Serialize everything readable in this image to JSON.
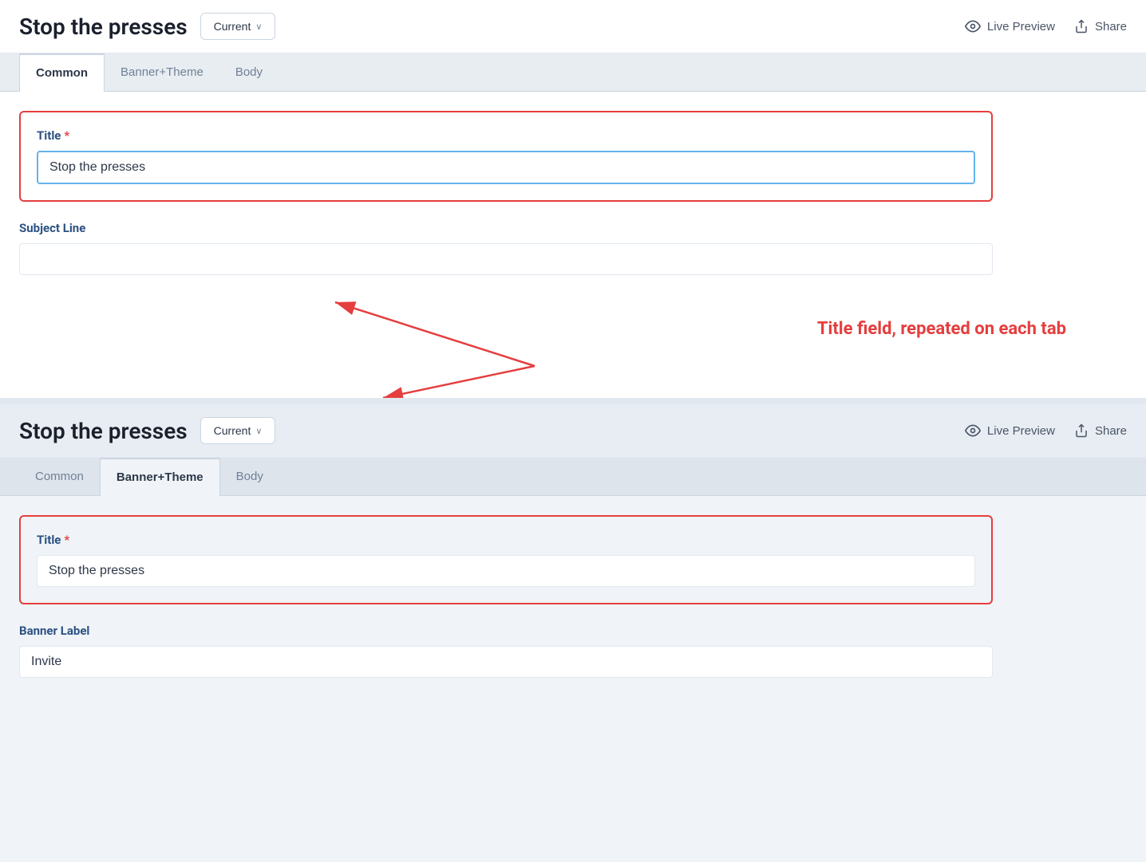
{
  "app": {
    "title": "Stop the presses"
  },
  "panel1": {
    "header": {
      "title": "Stop the presses",
      "dropdown_label": "Current",
      "live_preview_label": "Live Preview",
      "share_label": "Share"
    },
    "tabs": [
      {
        "id": "common",
        "label": "Common",
        "active": true
      },
      {
        "id": "banner-theme",
        "label": "Banner+Theme",
        "active": false
      },
      {
        "id": "body",
        "label": "Body",
        "active": false
      }
    ],
    "form": {
      "title_label": "Title",
      "title_value": "Stop the presses",
      "subject_label": "Subject Line",
      "subject_value": ""
    }
  },
  "annotation": {
    "text": "Title field, repeated on each tab"
  },
  "panel2": {
    "header": {
      "title": "Stop the presses",
      "dropdown_label": "Current",
      "live_preview_label": "Live Preview",
      "share_label": "Share"
    },
    "tabs": [
      {
        "id": "common",
        "label": "Common",
        "active": false
      },
      {
        "id": "banner-theme",
        "label": "Banner+Theme",
        "active": true
      },
      {
        "id": "body",
        "label": "Body",
        "active": false
      }
    ],
    "form": {
      "title_label": "Title",
      "title_value": "Stop the presses",
      "banner_label": "Banner Label",
      "banner_value": "Invite"
    }
  },
  "icons": {
    "eye": "👁",
    "share": "↪",
    "chevron": "∨"
  }
}
